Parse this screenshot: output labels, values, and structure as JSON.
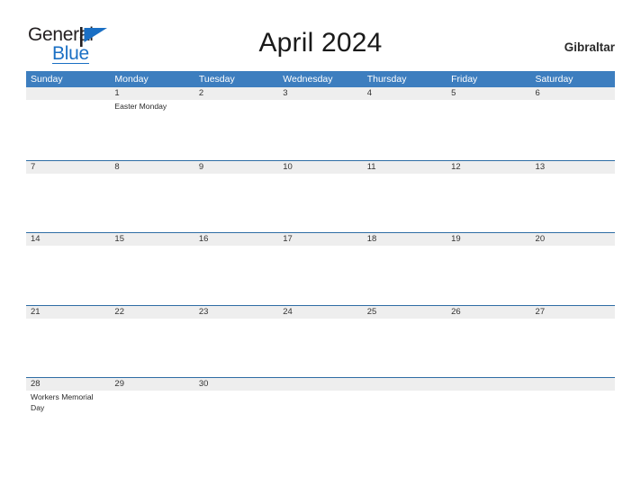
{
  "brand": {
    "name_part1": "General",
    "name_part2": "Blue",
    "flag_icon": "flag-icon",
    "accent_color": "#1a6fc4"
  },
  "header": {
    "title": "April 2024",
    "region": "Gibraltar"
  },
  "theme": {
    "header_bar_color": "#3d7ebf",
    "row_border_color": "#2e6da4",
    "date_band_color": "#eeeeee",
    "page_background": "#ffffff"
  },
  "calendar": {
    "month": "April",
    "year": "2024",
    "weekday_headers": [
      "Sunday",
      "Monday",
      "Tuesday",
      "Wednesday",
      "Thursday",
      "Friday",
      "Saturday"
    ],
    "weeks": [
      {
        "days": [
          {
            "number": "",
            "events": []
          },
          {
            "number": "1",
            "events": [
              "Easter Monday"
            ]
          },
          {
            "number": "2",
            "events": []
          },
          {
            "number": "3",
            "events": []
          },
          {
            "number": "4",
            "events": []
          },
          {
            "number": "5",
            "events": []
          },
          {
            "number": "6",
            "events": []
          }
        ]
      },
      {
        "days": [
          {
            "number": "7",
            "events": []
          },
          {
            "number": "8",
            "events": []
          },
          {
            "number": "9",
            "events": []
          },
          {
            "number": "10",
            "events": []
          },
          {
            "number": "11",
            "events": []
          },
          {
            "number": "12",
            "events": []
          },
          {
            "number": "13",
            "events": []
          }
        ]
      },
      {
        "days": [
          {
            "number": "14",
            "events": []
          },
          {
            "number": "15",
            "events": []
          },
          {
            "number": "16",
            "events": []
          },
          {
            "number": "17",
            "events": []
          },
          {
            "number": "18",
            "events": []
          },
          {
            "number": "19",
            "events": []
          },
          {
            "number": "20",
            "events": []
          }
        ]
      },
      {
        "days": [
          {
            "number": "21",
            "events": []
          },
          {
            "number": "22",
            "events": []
          },
          {
            "number": "23",
            "events": []
          },
          {
            "number": "24",
            "events": []
          },
          {
            "number": "25",
            "events": []
          },
          {
            "number": "26",
            "events": []
          },
          {
            "number": "27",
            "events": []
          }
        ]
      },
      {
        "days": [
          {
            "number": "28",
            "events": [
              "Workers Memorial Day"
            ]
          },
          {
            "number": "29",
            "events": []
          },
          {
            "number": "30",
            "events": []
          },
          {
            "number": "",
            "events": []
          },
          {
            "number": "",
            "events": []
          },
          {
            "number": "",
            "events": []
          },
          {
            "number": "",
            "events": []
          }
        ]
      }
    ]
  }
}
